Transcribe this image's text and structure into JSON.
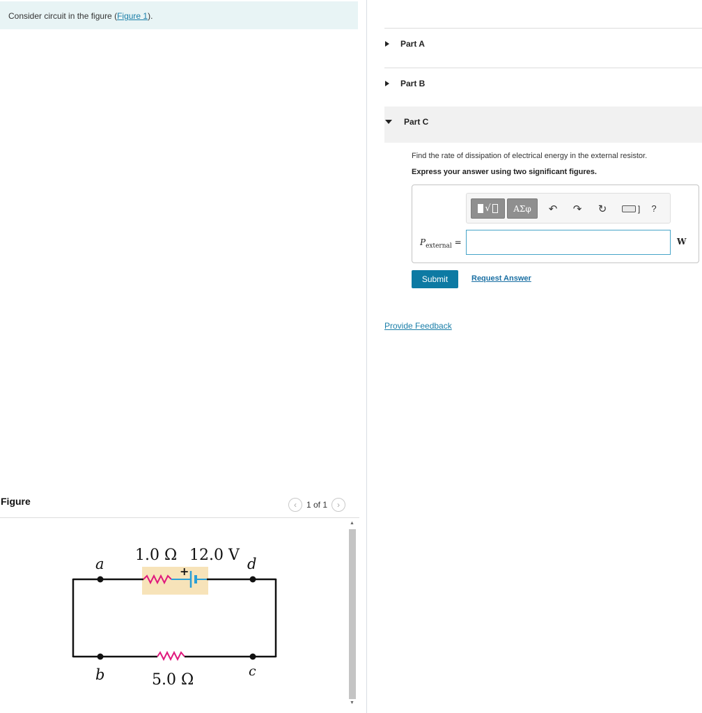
{
  "intro": {
    "text_before": "Consider circuit in the figure (",
    "link": "Figure 1",
    "text_after": ")."
  },
  "figure": {
    "label": "Figure",
    "pager": "1 of 1",
    "prev_icon": "chevron-left-icon",
    "next_icon": "chevron-right-icon",
    "circuit": {
      "internal_resistance": "1.0 Ω",
      "emf": "12.0 V",
      "external_resistance": "5.0 Ω",
      "plus_sign": "+",
      "node_a": "a",
      "node_b": "b",
      "node_c": "c",
      "node_d": "d",
      "wire_color": "#111111",
      "resistor_color": "#e0197d",
      "battery_color": "#2a9fd6",
      "highlight_color": "#f7e3b9"
    }
  },
  "parts": {
    "a_label": "Part A",
    "b_label": "Part B",
    "c_label": "Part C"
  },
  "part_c": {
    "question": "Find the rate of dissipation of electrical energy in the external resistor.",
    "instruction": "Express your answer using two significant figures.",
    "toolbar": {
      "greek": "ΑΣφ",
      "undo_icon": "undo-icon",
      "redo_icon": "redo-icon",
      "reset_icon": "reset-icon",
      "keyboard_icon": "keyboard-icon",
      "help": "?"
    },
    "variable_symbol": "P",
    "variable_subscript": "external",
    "equals": "=",
    "input_value": "",
    "unit": "W",
    "submit_label": "Submit",
    "request_answer_label": "Request Answer"
  },
  "feedback_label": "Provide Feedback",
  "colors": {
    "accent": "#0d7aa3",
    "link": "#1a7ea8",
    "intro_bg": "#e8f4f5"
  }
}
